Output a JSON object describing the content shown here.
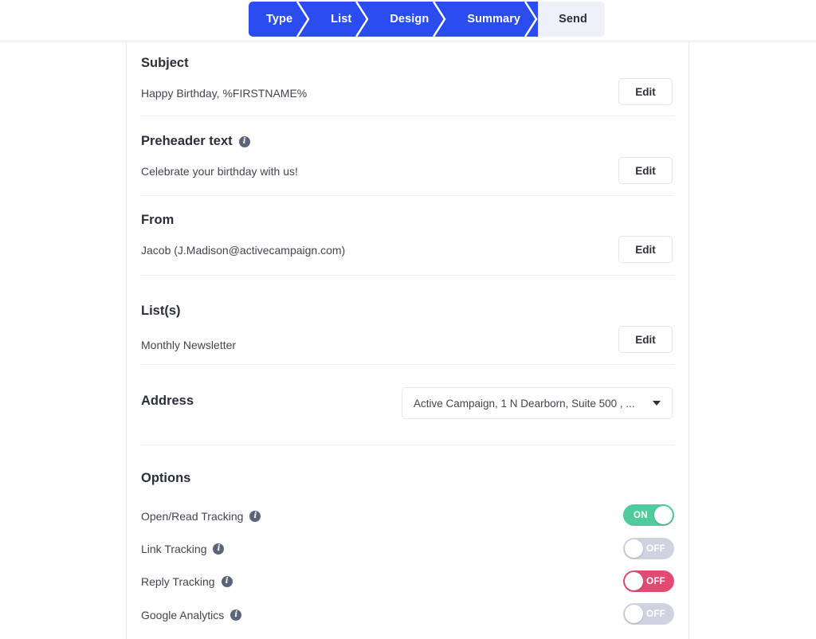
{
  "stepnav": {
    "steps": [
      {
        "label": "Type",
        "state": "done"
      },
      {
        "label": "List",
        "state": "done"
      },
      {
        "label": "Design",
        "state": "done"
      },
      {
        "label": "Summary",
        "state": "current"
      },
      {
        "label": "Send",
        "state": "upcoming"
      }
    ],
    "active_color": "#2b4df0",
    "upcoming_color": "#eef0fa"
  },
  "summary": {
    "subject": {
      "title": "Subject",
      "value": "Happy Birthday, %FIRSTNAME%",
      "edit_label": "Edit"
    },
    "preheader": {
      "title": "Preheader text",
      "value": "Celebrate your birthday with us!",
      "edit_label": "Edit",
      "info": "i"
    },
    "from": {
      "title": "From",
      "value": "Jacob (J.Madison@activecampaign.com)",
      "edit_label": "Edit"
    },
    "lists": {
      "title": "List(s)",
      "value": "Monthly Newsletter",
      "edit_label": "Edit"
    },
    "address": {
      "title": "Address",
      "selected": "Active Campaign, 1 N Dearborn, Suite 500 , ..."
    },
    "options": {
      "title": "Options",
      "rows": [
        {
          "label": "Open/Read Tracking",
          "state": "ON",
          "style": "on",
          "info": "i"
        },
        {
          "label": "Link Tracking",
          "state": "OFF",
          "style": "off",
          "info": "i"
        },
        {
          "label": "Reply Tracking",
          "state": "OFF",
          "style": "danger",
          "info": "i"
        },
        {
          "label": "Google Analytics",
          "state": "OFF",
          "style": "off",
          "info": "i"
        }
      ],
      "colors": {
        "on": "#4ecb9a",
        "off": "#cfd3e0",
        "danger": "#e24a72"
      }
    }
  }
}
